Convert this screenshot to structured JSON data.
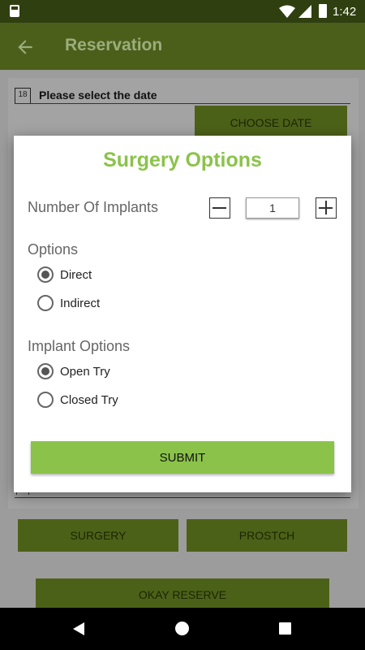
{
  "status_bar": {
    "time": "1:42"
  },
  "app_bar": {
    "title": "Reservation"
  },
  "background": {
    "date_label": "Please select the date",
    "date_icon_text": "18",
    "choose_date_button": "CHOOSE DATE",
    "surgery_button": "SURGERY",
    "prostch_button": "PROSTCH",
    "okay_reserve_button": "OKAY RESERVE"
  },
  "dialog": {
    "title": "Surgery Options",
    "implants_label": "Number Of Implants",
    "implants_value": "1",
    "options_label": "Options",
    "options": [
      {
        "label": "Direct",
        "checked": true
      },
      {
        "label": "Indirect",
        "checked": false
      }
    ],
    "implant_options_label": "Implant Options",
    "implant_options": [
      {
        "label": "Open Try",
        "checked": true
      },
      {
        "label": "Closed Try",
        "checked": false
      }
    ],
    "submit_button": "SUBMIT"
  },
  "colors": {
    "primary_dark": "#4b5f1a",
    "accent_green": "#8bc34a",
    "status_bar": "#2f3f0f"
  }
}
